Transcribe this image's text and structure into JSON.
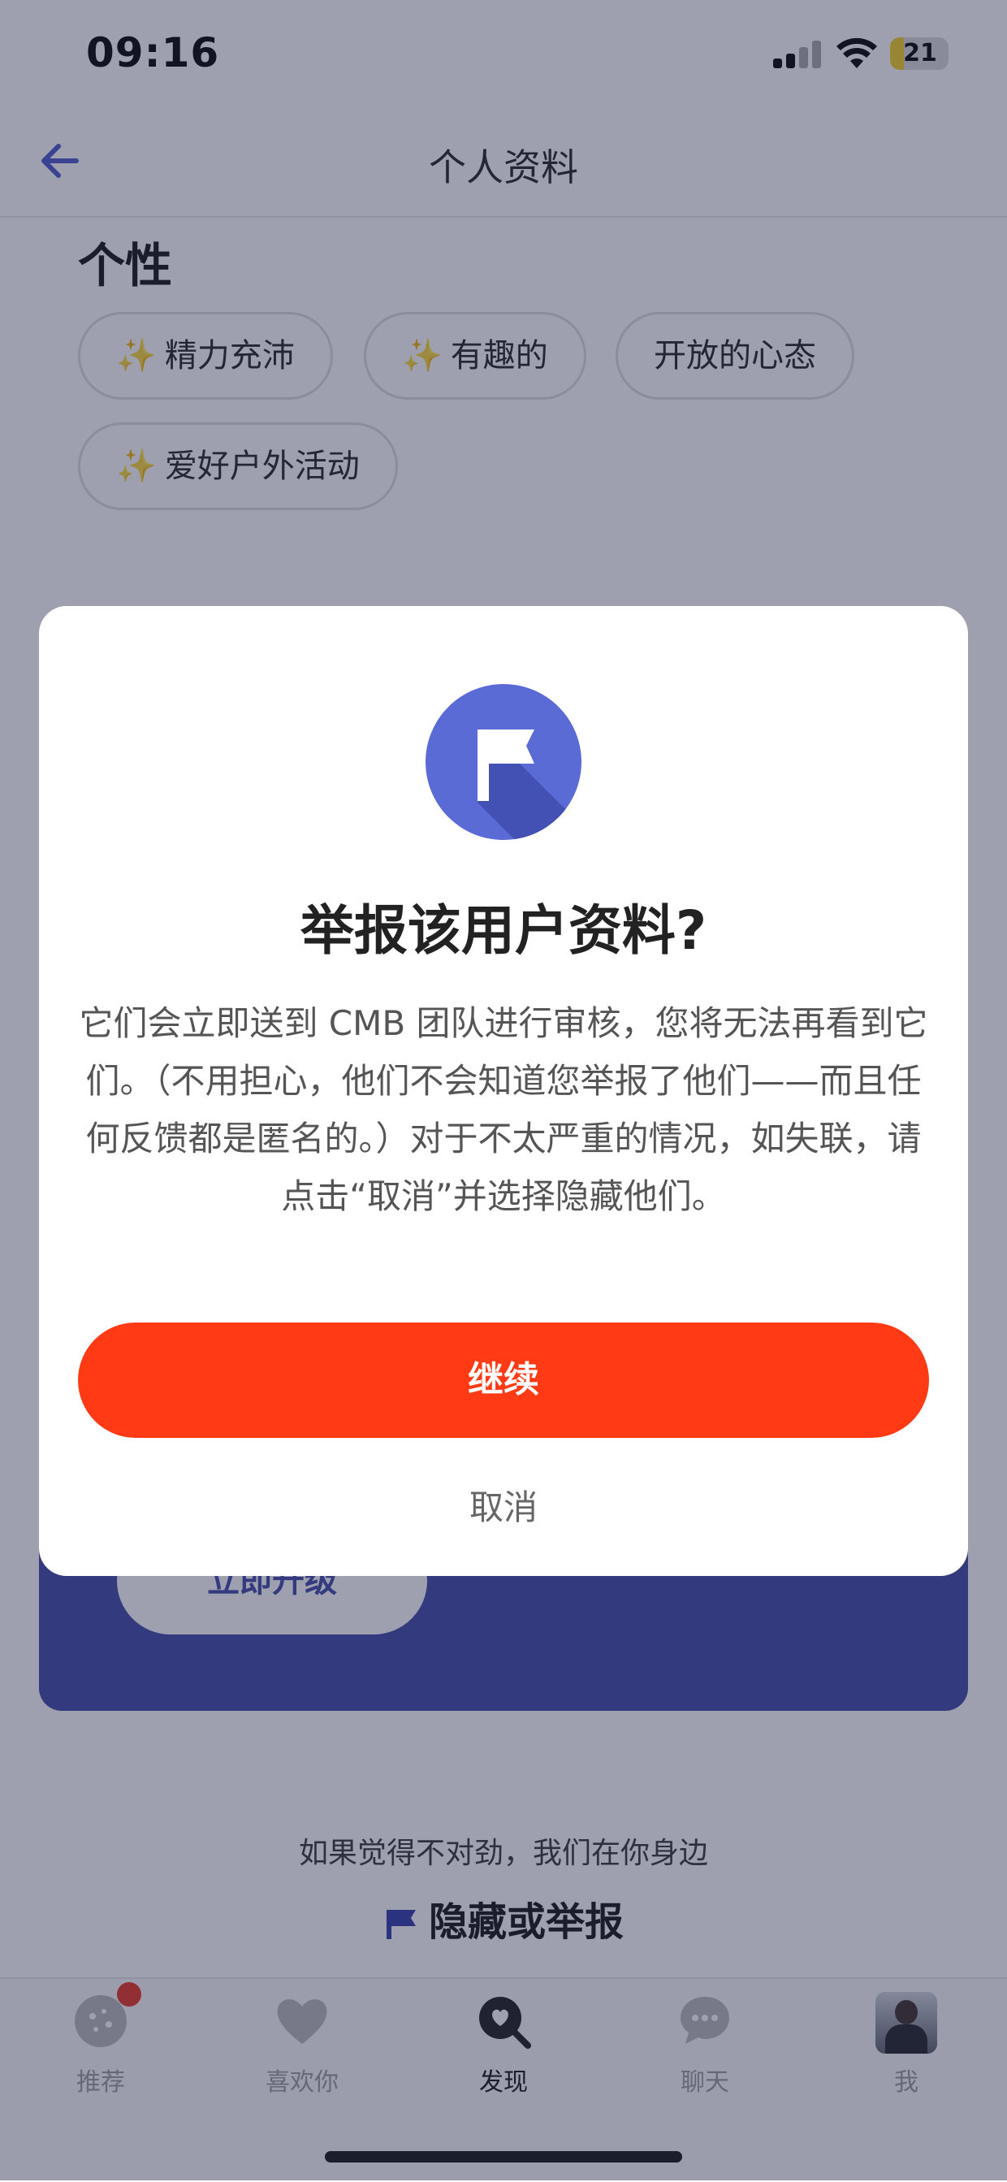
{
  "status_bar": {
    "time": "09:16",
    "battery": "21"
  },
  "nav": {
    "title": "个人资料"
  },
  "personality": {
    "title": "个性",
    "chips": [
      {
        "emoji": "✨",
        "label": "精力充沛"
      },
      {
        "emoji": "✨",
        "label": "有趣的"
      },
      {
        "emoji": "",
        "label": "开放的心态"
      },
      {
        "emoji": "✨",
        "label": "爱好户外活动"
      }
    ]
  },
  "promo": {
    "upgrade_label": "立即升级"
  },
  "safety": {
    "prompt": "如果觉得不对劲，我们在你身边",
    "hide_report_label": "隐藏或举报"
  },
  "tabs": [
    {
      "label": "推荐",
      "icon": "recommend-icon",
      "badge": true
    },
    {
      "label": "喜欢你",
      "icon": "heart-icon"
    },
    {
      "label": "发现",
      "icon": "discover-icon",
      "active": true
    },
    {
      "label": "聊天",
      "icon": "chat-icon"
    },
    {
      "label": "我",
      "icon": "avatar"
    }
  ],
  "modal": {
    "title": "举报该用户资料?",
    "body": "它们会立即送到 CMB 团队进行审核，您将无法再看到它们。（不用担心，他们不会知道您举报了他们——而且任何反馈都是匿名的。）对于不太严重的情况，如失联，请点击“取消”并选择隐藏他们。",
    "continue_label": "继续",
    "cancel_label": "取消",
    "icon": "flag-icon"
  },
  "colors": {
    "accent": "#ff3a14",
    "brand": "#3c45a3",
    "flag_badge": "#5b6bd6"
  }
}
